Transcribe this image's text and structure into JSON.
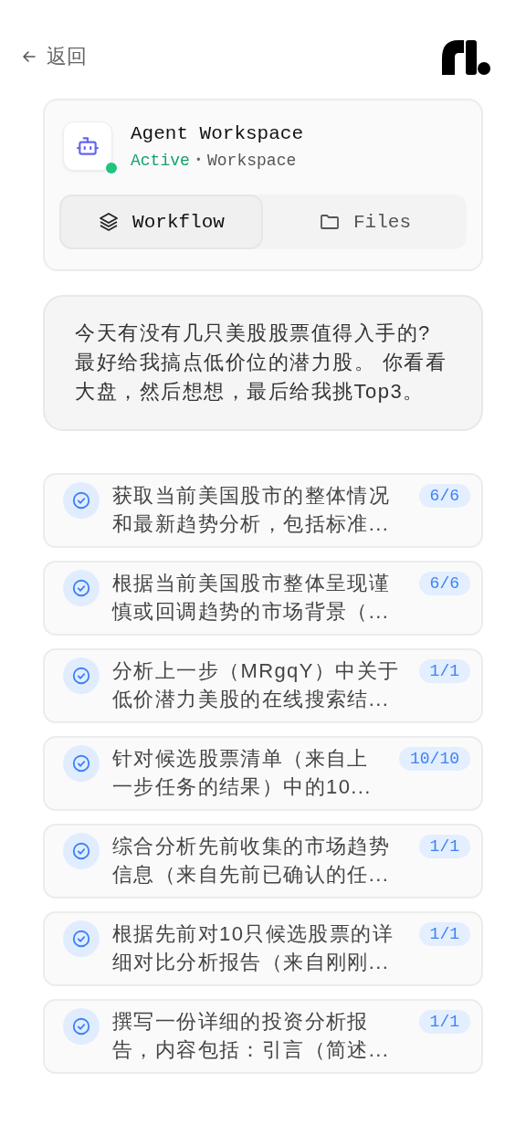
{
  "back": {
    "label": "返回"
  },
  "agent": {
    "name": "Agent Workspace",
    "status": "Active",
    "online": true,
    "separator": "•",
    "type": "Workspace"
  },
  "tabs": [
    {
      "label": "Workflow",
      "selected": true
    },
    {
      "label": "Files",
      "selected": false
    }
  ],
  "message": "今天有没有几只美股股票值得入手的?\n最好给我搞点低价位的潜力股。 你看看大盘，然后想想，最后给我挑Top3。",
  "tasks": [
    {
      "text": "获取当前美国股市的整体情况和最新趋势分析，包括标准...",
      "progress": "6/6",
      "done": true
    },
    {
      "text": "根据当前美国股市整体呈现谨慎或回调趋势的市场背景（...",
      "progress": "6/6",
      "done": true
    },
    {
      "text": "分析上一步（MRgqY）中关于低价潜力美股的在线搜索结...",
      "progress": "1/1",
      "done": true
    },
    {
      "text": "针对候选股票清单（来自上一步任务的结果）中的10...",
      "progress": "10/10",
      "done": true
    },
    {
      "text": "综合分析先前收集的市场趋势信息（来自先前已确认的任...",
      "progress": "1/1",
      "done": true
    },
    {
      "text": "根据先前对10只候选股票的详细对比分析报告（来自刚刚...",
      "progress": "1/1",
      "done": true
    },
    {
      "text": "撰写一份详细的投资分析报告，内容包括：引言（简述...",
      "progress": "1/1",
      "done": true
    }
  ]
}
